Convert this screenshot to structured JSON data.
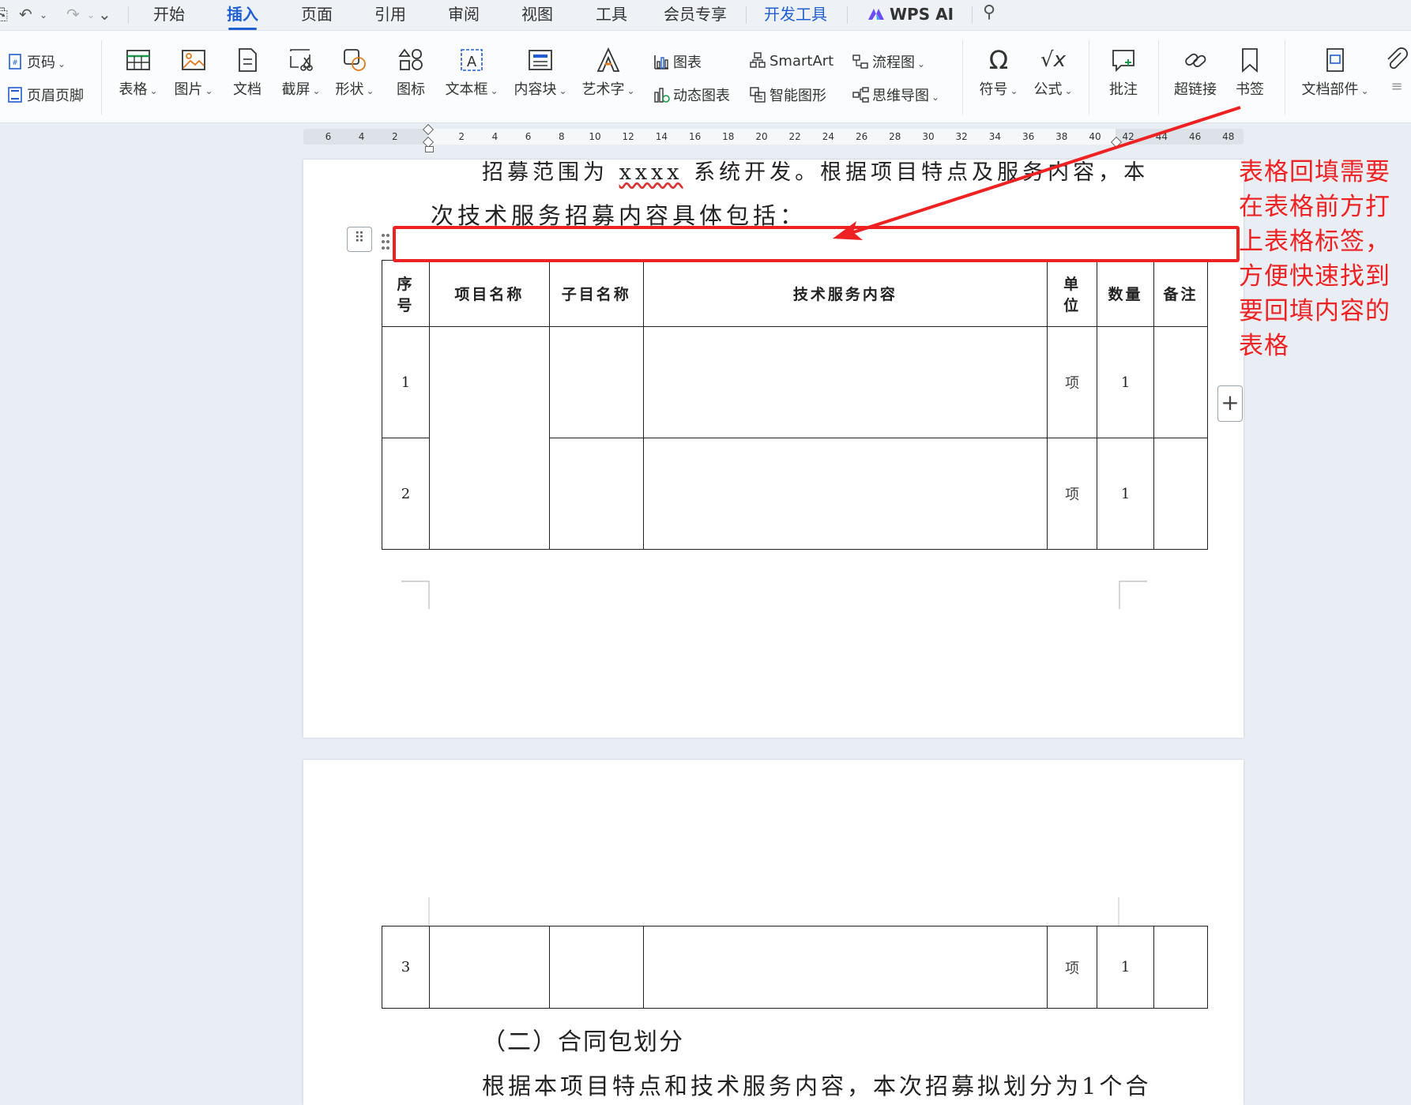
{
  "tabs": {
    "home": "开始",
    "insert": "插入",
    "page": "页面",
    "reference": "引用",
    "review": "审阅",
    "view": "视图",
    "tools": "工具",
    "member": "会员专享",
    "developer": "开发工具",
    "wps_ai": "WPS AI"
  },
  "ribbon": {
    "page_number": "页码",
    "header_footer": "页眉页脚",
    "table": "表格",
    "picture": "图片",
    "document": "文档",
    "screenshot": "截屏",
    "shape": "形状",
    "icon": "图标",
    "textbox": "文本框",
    "content_block": "内容块",
    "wordart": "艺术字",
    "chart": "图表",
    "dynamic_chart": "动态图表",
    "smartart": "SmartArt",
    "smart_graphic": "智能图形",
    "flowchart": "流程图",
    "mindmap": "思维导图",
    "symbol": "符号",
    "formula": "公式",
    "comment": "批注",
    "hyperlink": "超链接",
    "bookmark": "书签",
    "doc_parts": "文档部件"
  },
  "ruler": {
    "numbers": [
      "6",
      "4",
      "2",
      "2",
      "4",
      "6",
      "8",
      "10",
      "12",
      "14",
      "16",
      "18",
      "20",
      "22",
      "24",
      "26",
      "28",
      "30",
      "32",
      "34",
      "36",
      "38",
      "40",
      "42",
      "44",
      "46",
      "48"
    ]
  },
  "document": {
    "line1_a": "招募范围为",
    "line1_b": "xxxx",
    "line1_c": "系统开发。根据项目特点及服务内容，本",
    "line2": "次技术服务招募内容具体包括：",
    "table_headers": {
      "seq_1": "序",
      "seq_2": "号",
      "project": "项目名称",
      "sub": "子目名称",
      "content": "技术服务内容",
      "unit_1": "单",
      "unit_2": "位",
      "qty": "数量",
      "remark": "备注"
    },
    "rows": [
      {
        "seq": "1",
        "unit": "项",
        "qty": "1"
      },
      {
        "seq": "2",
        "unit": "项",
        "qty": "1"
      },
      {
        "seq": "3",
        "unit": "项",
        "qty": "1"
      }
    ],
    "heading": "（二）合同包划分",
    "bottom_line": "根据本项目特点和技术服务内容，本次招募拟划分为1个合"
  },
  "annotation": {
    "lines": [
      "表格回填需要",
      "在表格前方打",
      "上表格标签，",
      "方便快速找到",
      "要回填内容的",
      "表格"
    ]
  },
  "colors": {
    "accent": "#1f5fd1",
    "annotation_red": "#ee2222"
  }
}
